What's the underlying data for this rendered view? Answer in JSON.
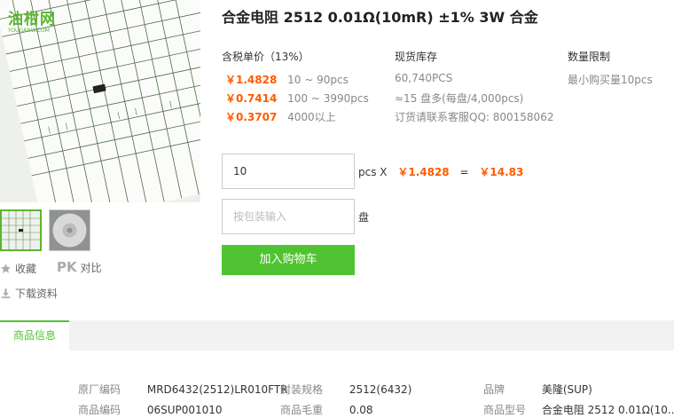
{
  "logo": {
    "cn": "油柑网",
    "en": "YOUGANW.COM"
  },
  "actions": {
    "favorite": "收藏",
    "compare_pk": "PK",
    "compare": "对比",
    "download": "下载资料"
  },
  "product": {
    "title": "合金电阻 2512 0.01Ω(10mR) ±1% 3W 合金"
  },
  "pricing": {
    "header": "含税单价（13%）",
    "tiers": [
      {
        "price": "￥1.4828",
        "range": "10 ~ 90pcs"
      },
      {
        "price": "￥0.7414",
        "range": "100 ~ 3990pcs"
      },
      {
        "price": "￥0.3707",
        "range": "4000以上"
      }
    ]
  },
  "stock": {
    "header": "现货库存",
    "qty": "60,740PCS",
    "reels": "≈15 盘多(每盘/4,000pcs)",
    "contact": "订货请联系客服QQ: 800158062"
  },
  "limit": {
    "header": "数量限制",
    "text": "最小购买量10pcs"
  },
  "order": {
    "qty_value": "10",
    "qty_unit": "pcs X",
    "unit_price": "￥1.4828",
    "equals": "=",
    "total": "￥14.83",
    "reel_placeholder": "按包装输入",
    "reel_unit": "盘",
    "add_to_cart": "加入购物车"
  },
  "tabs": {
    "info": "商品信息"
  },
  "specs": {
    "mfr_code_label": "原厂编码",
    "mfr_code": "MRD6432(2512)LR010FTR",
    "package_label": "封装规格",
    "package": "2512(6432)",
    "brand_label": "品牌",
    "brand": "美隆(SUP)",
    "item_code_label": "商品编码",
    "item_code": "06SUP001010",
    "weight_label": "商品毛重",
    "weight": "0.08",
    "model_label": "商品型号",
    "model": "合金电阻 2512 0.01Ω(10..."
  },
  "colors": {
    "accent": "#4fc331",
    "price": "#ff5a00",
    "logo": "#5cb531"
  }
}
